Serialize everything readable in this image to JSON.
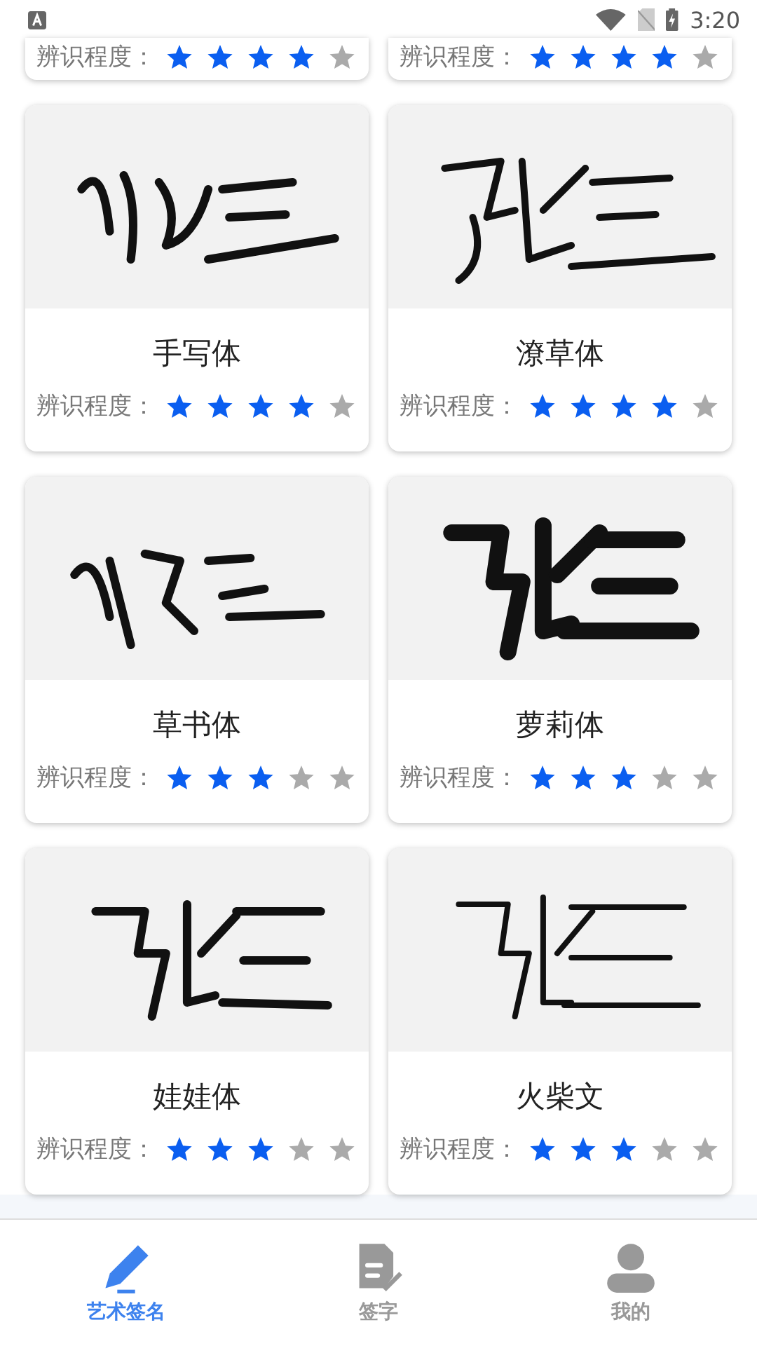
{
  "status_bar": {
    "time": "3:20"
  },
  "partial_cards": [
    {
      "rating_label": "辨识程度：",
      "stars": 4
    },
    {
      "rating_label": "辨识程度：",
      "stars": 4
    }
  ],
  "cards": [
    {
      "name": "手写体",
      "rating_label": "辨识程度：",
      "stars": 4
    },
    {
      "name": "潦草体",
      "rating_label": "辨识程度：",
      "stars": 4
    },
    {
      "name": "草书体",
      "rating_label": "辨识程度：",
      "stars": 3
    },
    {
      "name": "萝莉体",
      "rating_label": "辨识程度：",
      "stars": 3
    },
    {
      "name": "娃娃体",
      "rating_label": "辨识程度：",
      "stars": 3
    },
    {
      "name": "火柴文",
      "rating_label": "辨识程度：",
      "stars": 3
    }
  ],
  "nav": [
    {
      "label": "艺术签名",
      "kind": "pencil",
      "selected": true
    },
    {
      "label": "签字",
      "kind": "document",
      "selected": false
    },
    {
      "label": "我的",
      "kind": "person",
      "selected": false
    }
  ]
}
